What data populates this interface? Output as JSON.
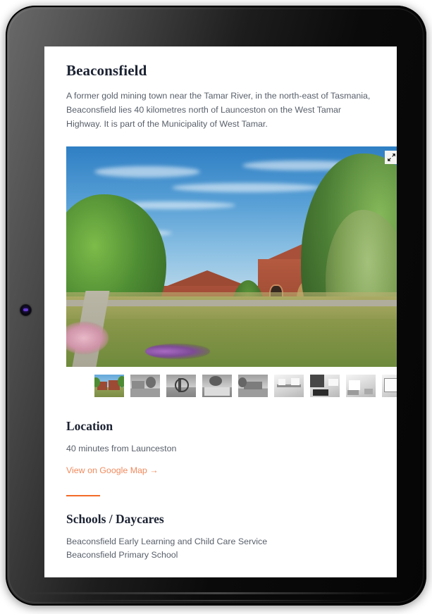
{
  "device": {
    "camera_icon": "front-camera-lens"
  },
  "page": {
    "title": "Beaconsfield",
    "description": "A former gold mining town near the Tamar River, in the north-east of Tasmania, Beaconsfield lies 40 kilometres north of Launceston on the West Tamar Highway. It is part of the Municipality of West Tamar."
  },
  "gallery": {
    "expand_icon": "expand-fullscreen-icon",
    "active_index": 0,
    "thumbnails": [
      {
        "name": "brick-heritage-buildings",
        "active": true
      },
      {
        "name": "town-street-view",
        "active": false
      },
      {
        "name": "mine-wheel-monument",
        "active": false
      },
      {
        "name": "white-fence-building",
        "active": false
      },
      {
        "name": "shopfront-street",
        "active": false
      },
      {
        "name": "museum-interior-machinery",
        "active": false
      },
      {
        "name": "interior-lounge-dark",
        "active": false
      },
      {
        "name": "interior-living-room",
        "active": false
      },
      {
        "name": "interior-hallway",
        "active": false
      }
    ]
  },
  "sections": {
    "location": {
      "title": "Location",
      "text": "40 minutes from Launceston",
      "link_label": "View on Google Map →"
    },
    "schools": {
      "title": "Schools / Daycares",
      "items": [
        "Beaconsfield Early Learning and Child Care Service",
        "Beaconsfield Primary School"
      ]
    }
  },
  "colors": {
    "accent_orange": "#f26b28",
    "link_orange": "#f08a5d",
    "heading": "#1b2232",
    "body_text": "#59606b"
  }
}
